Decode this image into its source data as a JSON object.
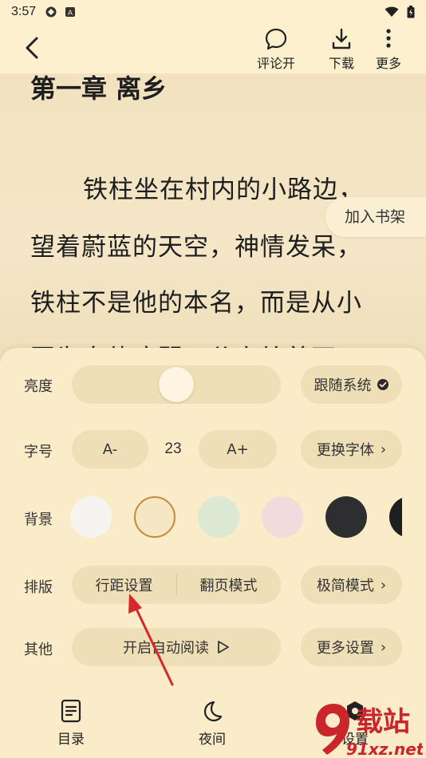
{
  "status_bar": {
    "time": "3:57"
  },
  "top_bar": {
    "comment_label": "评论开",
    "download_label": "下载",
    "more_label": "更多"
  },
  "reader": {
    "chapter_title": "第一章 离乡",
    "lines": [
      "铁柱坐在村内的小路边，",
      "望着蔚蓝的天空，神情发呆，",
      "铁柱不是他的本名，而是从小",
      "因为身体瘦弱，父亲给着不"
    ],
    "add_shelf_label": "加入书架"
  },
  "settings": {
    "brightness": {
      "label": "亮度",
      "level": 0.5,
      "follow_system_label": "跟随系统"
    },
    "font_size": {
      "label": "字号",
      "decrease_label": "A-",
      "value": "23",
      "increase_label": "A+",
      "change_font_label": "更换字体"
    },
    "background": {
      "label": "背景",
      "swatches": [
        "#f6f4f0",
        "#f5e6c6",
        "#dbe8d2",
        "#f0dcdc",
        "#2e2e30",
        "#1f1f22"
      ],
      "selected_index": 1,
      "selected_ring_color": "#c8883a"
    },
    "layout": {
      "label": "排版",
      "line_spacing_label": "行距设置",
      "page_mode_label": "翻页模式",
      "minimal_label": "极简模式"
    },
    "other": {
      "label": "其他",
      "auto_read_label": "开启自动阅读",
      "more_settings_label": "更多设置"
    }
  },
  "bottom_nav": {
    "toc_label": "目录",
    "night_label": "夜间",
    "settings_label": "设置"
  },
  "annotation": {
    "arrow_color": "#d8262b"
  },
  "watermark": {
    "text_main": "载站",
    "text_sub": "91xz.net",
    "color": "#c9252b"
  }
}
